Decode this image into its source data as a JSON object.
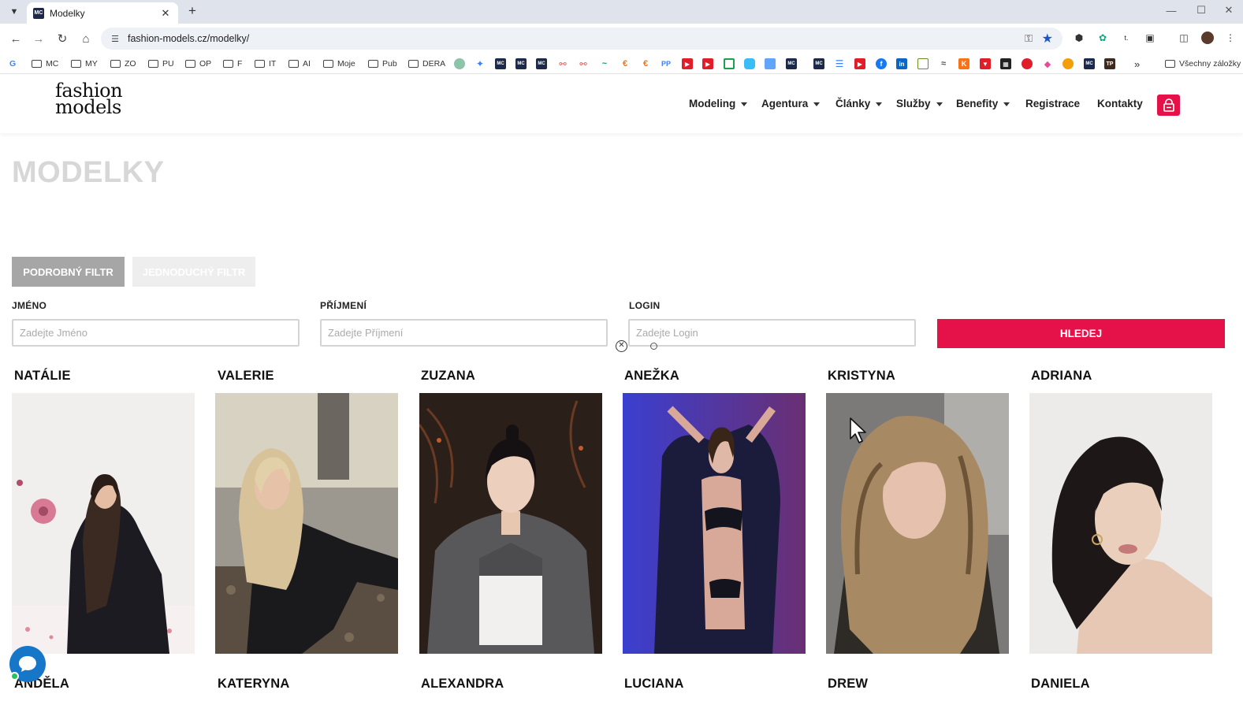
{
  "browser": {
    "tab_title": "Modelky",
    "tab_favicon": "MC",
    "url": "fashion-models.cz/modelky/",
    "bookmarks": [
      {
        "label": "MC",
        "icon": "folder-icon"
      },
      {
        "label": "MY",
        "icon": "folder-icon"
      },
      {
        "label": "ZO",
        "icon": "folder-icon"
      },
      {
        "label": "PU",
        "icon": "folder-icon"
      },
      {
        "label": "OP",
        "icon": "folder-icon"
      },
      {
        "label": "F",
        "icon": "folder-icon"
      },
      {
        "label": "IT",
        "icon": "folder-icon"
      },
      {
        "label": "AI",
        "icon": "folder-icon"
      },
      {
        "label": "Moje",
        "icon": "folder-icon"
      },
      {
        "label": "Pub",
        "icon": "folder-icon"
      },
      {
        "label": "DERA",
        "icon": "folder-icon"
      }
    ],
    "all_bookmarks_label": "Všechny záložky",
    "more_label": "»"
  },
  "site": {
    "logo_line1": "fashion",
    "logo_line2": "models",
    "accent_color": "#e5124a",
    "menu": [
      {
        "label": "Modeling",
        "dropdown": true
      },
      {
        "label": "Agentura",
        "dropdown": true
      },
      {
        "label": "Články",
        "dropdown": true
      },
      {
        "label": "Služby",
        "dropdown": true
      },
      {
        "label": "Benefity",
        "dropdown": true
      },
      {
        "label": "Registrace",
        "dropdown": false
      },
      {
        "label": "Kontakty",
        "dropdown": false
      }
    ]
  },
  "page": {
    "title": "MODELKY",
    "filter_tabs": {
      "detailed": "PODROBNÝ FILTR",
      "simple": "JEDNODUCHÝ FILTR"
    },
    "fields": {
      "first_name": {
        "label": "JMÉNO",
        "placeholder": "Zadejte Jméno",
        "value": ""
      },
      "last_name": {
        "label": "PŘÍJMENÍ",
        "placeholder": "Zadejte Příjmení",
        "value": ""
      },
      "login": {
        "label": "LOGIN",
        "placeholder": "Zadejte Login",
        "value": ""
      }
    },
    "search_button": "HLEDEJ",
    "models_row1": [
      {
        "name": "NATÁLIE"
      },
      {
        "name": "VALERIE"
      },
      {
        "name": "ZUZANA"
      },
      {
        "name": "ANEŽKA"
      },
      {
        "name": "KRISTYNA"
      },
      {
        "name": "ADRIANA"
      }
    ],
    "models_row2": [
      {
        "name": "ANDĚLA"
      },
      {
        "name": "KATERYNA"
      },
      {
        "name": "ALEXANDRA"
      },
      {
        "name": "LUCIANA"
      },
      {
        "name": "DREW"
      },
      {
        "name": "DANIELA"
      }
    ]
  }
}
